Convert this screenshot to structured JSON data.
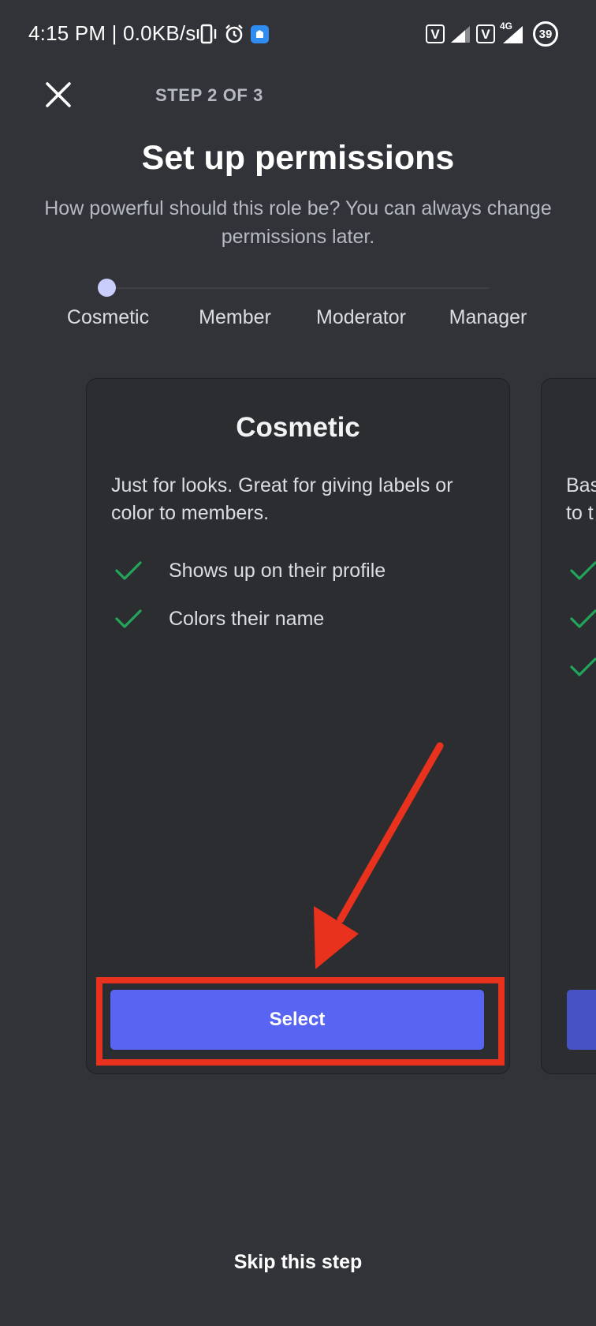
{
  "status_bar": {
    "time_text": "4:15 PM | 0.0KB/s",
    "network_type": "4G",
    "volte_label": "V",
    "battery_level": "39",
    "icons": [
      "vibrate-icon",
      "alarm-icon",
      "app-notification-icon",
      "volte-icon",
      "signal-icon",
      "volte-icon",
      "signal-icon",
      "battery-icon"
    ]
  },
  "header": {
    "close_icon": "close-icon",
    "step_label": "STEP 2 OF 3",
    "title": "Set up permissions",
    "subtitle": "How powerful should this role be? You can always change permissions later."
  },
  "permission_levels": {
    "selected": "Cosmetic",
    "options": [
      "Cosmetic",
      "Member",
      "Moderator",
      "Manager"
    ]
  },
  "cards": [
    {
      "title": "Cosmetic",
      "description": "Just for looks. Great for giving labels or color to members.",
      "features": [
        "Shows up on their profile",
        "Colors their name"
      ],
      "button_label": "Select"
    },
    {
      "title": "",
      "description_partial": "Bas\nto t",
      "feature_count": 3
    }
  ],
  "footer": {
    "skip_label": "Skip this step"
  },
  "colors": {
    "background": "#313338",
    "card": "#2b2d31",
    "accent": "#5865f2",
    "check": "#23a55a",
    "annotation": "#e8321e"
  }
}
